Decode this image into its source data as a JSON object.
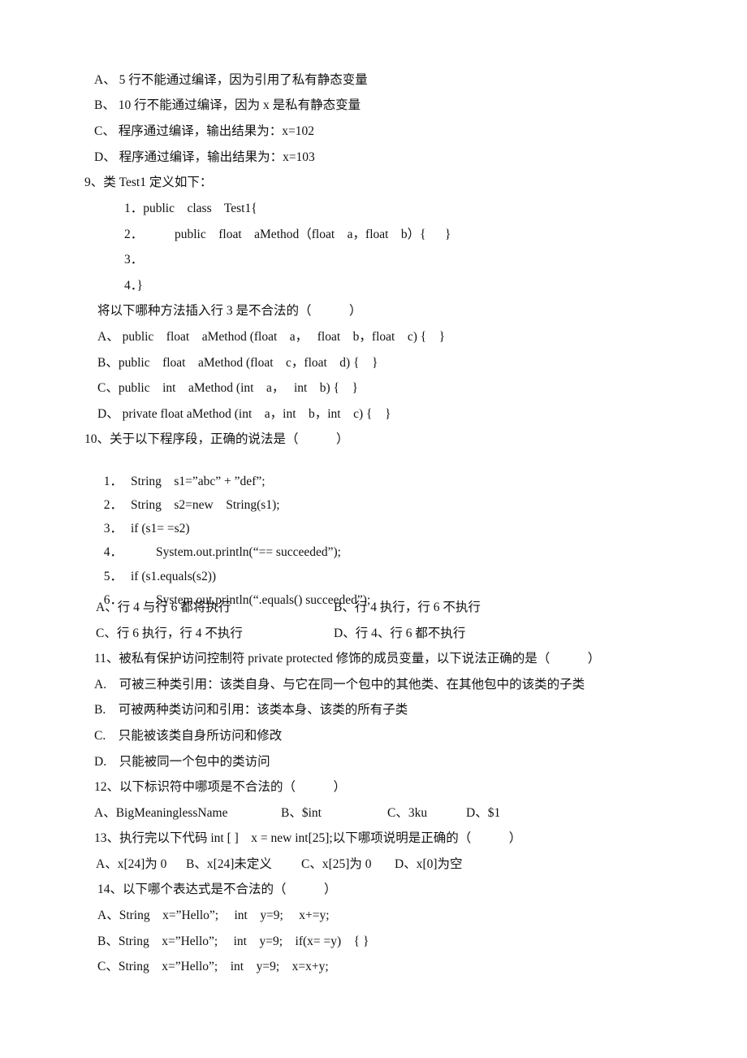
{
  "q8_options": [
    "A、 5 行不能通过编译，因为引用了私有静态变量",
    "B、 10 行不能通过编译，因为 x 是私有静态变量",
    "C、 程序通过编译，输出结果为：x=102",
    "D、 程序通过编译，输出结果为：x=103"
  ],
  "q9": {
    "title": "9、类 Test1 定义如下：",
    "code": [
      "1．public    class    Test1{",
      "2．          public    float    aMethod（float    a，float    b）{      }",
      "3．",
      "4．}"
    ],
    "prompt": "将以下哪种方法插入行 3 是不合法的（            ）",
    "options": [
      "A、 public    float    aMethod (float    a，   float    b，float    c) {    }",
      "B、public    float    aMethod (float    c，float    d) {    }",
      "C、public    int    aMethod (int    a，   int    b) {    }",
      "D、 private float aMethod (int    a，int    b，int    c) {    }"
    ]
  },
  "q10": {
    "title": "10、关于以下程序段，正确的说法是（            ）",
    "code": [
      {
        "num": "1．",
        "text": "String    s1=”abc” + ”def”;"
      },
      {
        "num": "2．",
        "text": "String    s2=new    String(s1);"
      },
      {
        "num": "3．",
        "text": "if (s1= =s2)"
      },
      {
        "num": "4．",
        "text": "        System.out.println(“== succeeded”);"
      },
      {
        "num": "5．",
        "text": "if (s1.equals(s2))"
      },
      {
        "num": "6．",
        "text": "        System.out.println(“.equals() succeeded”);"
      }
    ],
    "options": [
      "A、行 4 与行 6 都将执行",
      "B、行 4 执行，行 6 不执行",
      "C、行 6 执行，行 4 不执行",
      "D、行 4、行 6 都不执行"
    ]
  },
  "q11": {
    "title": "11、被私有保护访问控制符 private protected 修饰的成员变量，以下说法正确的是（            ）",
    "options": [
      "A.    可被三种类引用：该类自身、与它在同一个包中的其他类、在其他包中的该类的子类",
      "B.    可被两种类访问和引用：该类本身、该类的所有子类",
      "C.    只能被该类自身所访问和修改",
      "D.    只能被同一个包中的类访问"
    ]
  },
  "q12": {
    "title": "12、以下标识符中哪项是不合法的（            ）",
    "options": [
      "A、BigMeaninglessName",
      "B、$int",
      "C、3ku",
      "D、$1"
    ]
  },
  "q13": {
    "title": "13、执行完以下代码 int [ ]    x = new int[25];以下哪项说明是正确的（            ）",
    "options": [
      "A、x[24]为 0",
      "B、x[24]未定义",
      "C、x[25]为 0",
      "D、x[0]为空"
    ]
  },
  "q14": {
    "title": "14、以下哪个表达式是不合法的（            ）",
    "options": [
      "A、String    x=”Hello”;     int    y=9;     x+=y;",
      "B、String    x=”Hello”;     int    y=9;    if(x= =y)    { }",
      "C、String    x=”Hello”;    int    y=9;    x=x+y;"
    ]
  }
}
